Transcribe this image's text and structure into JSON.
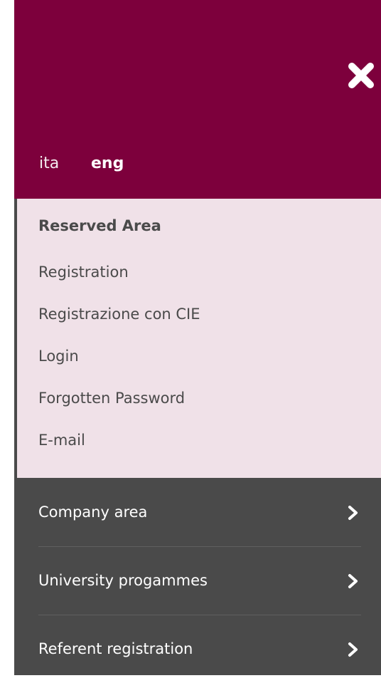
{
  "header": {
    "close_icon": "close-icon",
    "languages": {
      "ita": "ita",
      "eng": "eng",
      "active": "eng"
    },
    "background_color": "#7d003c"
  },
  "reserved_area": {
    "title": "Reserved Area",
    "items": [
      {
        "label": "Registration"
      },
      {
        "label": "Registrazione con CIE"
      },
      {
        "label": "Login"
      },
      {
        "label": "Forgotten Password"
      },
      {
        "label": "E-mail"
      }
    ],
    "background_color": "#f0e1e8"
  },
  "main_menu": {
    "items": [
      {
        "label": "Company area",
        "icon": "chevron-right-icon"
      },
      {
        "label": "University progammes",
        "icon": "chevron-right-icon"
      },
      {
        "label": "Referent registration",
        "icon": "chevron-right-icon"
      }
    ],
    "background_color": "#4a4a4a"
  }
}
